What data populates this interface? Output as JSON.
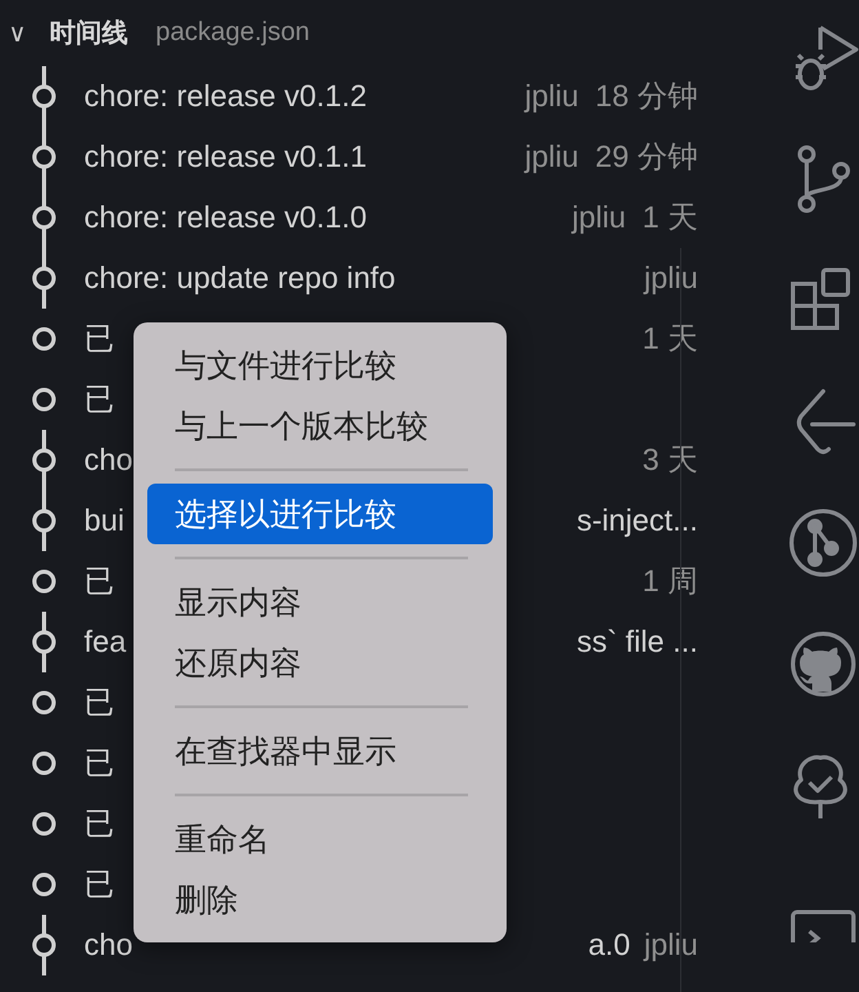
{
  "panel": {
    "chevron": "∨",
    "title": "时间线",
    "subtitle": "package.json"
  },
  "rows": [
    {
      "kind": "commit",
      "head": "chore: release v0.1.2",
      "tail": "",
      "author": "jpliu",
      "time": "18 分钟"
    },
    {
      "kind": "commit",
      "head": "chore: release v0.1.1",
      "tail": "",
      "author": "jpliu",
      "time": "29 分钟"
    },
    {
      "kind": "commit",
      "head": "chore: release v0.1.0",
      "tail": "",
      "author": "jpliu",
      "time": "1 天"
    },
    {
      "kind": "commit",
      "head": "chore: update repo info",
      "tail": "",
      "author": "jpliu",
      "time": ""
    },
    {
      "kind": "save",
      "head": "已",
      "tail": "",
      "author": "",
      "time": "1 天"
    },
    {
      "kind": "save",
      "head": "已",
      "tail": "",
      "author": "",
      "time": ""
    },
    {
      "kind": "commit",
      "head": "cho",
      "tail": "",
      "author": "",
      "time": "3 天"
    },
    {
      "kind": "commit",
      "head": "bui",
      "tail": "s-inject...",
      "author": "",
      "time": ""
    },
    {
      "kind": "save",
      "head": "已",
      "tail": "",
      "author": "",
      "time": "1 周"
    },
    {
      "kind": "commit",
      "head": "fea",
      "tail": "ss` file ...",
      "author": "",
      "time": ""
    },
    {
      "kind": "save",
      "head": "已",
      "tail": "",
      "author": "",
      "time": ""
    },
    {
      "kind": "save",
      "head": "已",
      "tail": "",
      "author": "",
      "time": ""
    },
    {
      "kind": "save",
      "head": "已",
      "tail": "",
      "author": "",
      "time": ""
    },
    {
      "kind": "save",
      "head": "已",
      "tail": "",
      "author": "",
      "time": ""
    },
    {
      "kind": "commit",
      "head": "cho",
      "tail": "a.0",
      "author": "jpliu",
      "time": ""
    }
  ],
  "context_menu": {
    "groups": [
      [
        {
          "label": "与文件进行比较",
          "selected": false
        },
        {
          "label": "与上一个版本比较",
          "selected": false
        }
      ],
      [
        {
          "label": "选择以进行比较",
          "selected": true
        }
      ],
      [
        {
          "label": "显示内容",
          "selected": false
        },
        {
          "label": "还原内容",
          "selected": false
        }
      ],
      [
        {
          "label": "在查找器中显示",
          "selected": false
        }
      ],
      [
        {
          "label": "重命名",
          "selected": false
        },
        {
          "label": "删除",
          "selected": false
        }
      ]
    ]
  },
  "activity_bar": [
    {
      "kind": "run"
    },
    {
      "kind": "branch"
    },
    {
      "kind": "extensions"
    },
    {
      "kind": "bracket"
    },
    {
      "kind": "pull"
    },
    {
      "kind": "github"
    },
    {
      "kind": "tree"
    },
    {
      "kind": "terminal"
    }
  ]
}
